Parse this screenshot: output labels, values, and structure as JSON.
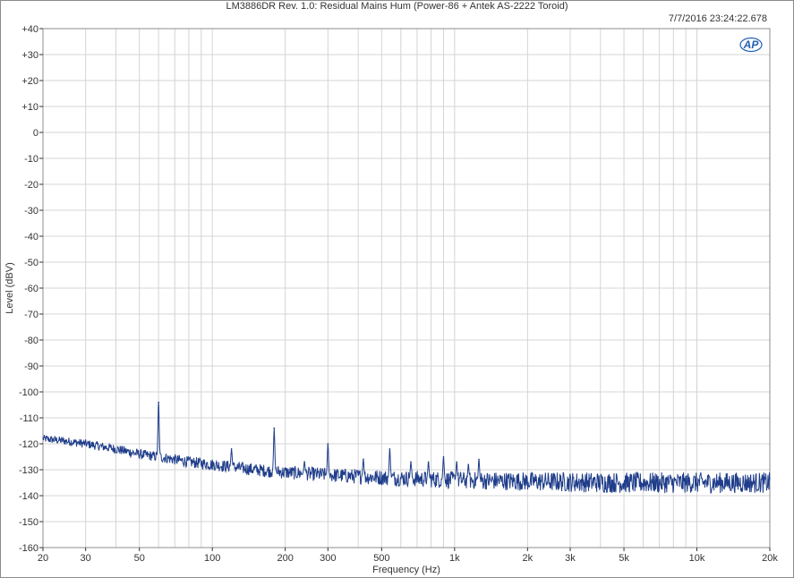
{
  "header": {
    "title": "LM3886DR Rev. 1.0: Residual Mains Hum (Power-86 + Antek AS-2222 Toroid)",
    "timestamp": "7/7/2016 23:24:22.678",
    "logo_text": "AP"
  },
  "colors": {
    "trace": "#1f3d8a",
    "grid": "#d4d4d4",
    "axis": "#333333",
    "logo": "#1e5fb4"
  },
  "chart_data": {
    "type": "line",
    "title": "LM3886DR Rev. 1.0: Residual Mains Hum (Power-86 + Antek AS-2222 Toroid)",
    "xlabel": "Frequency (Hz)",
    "ylabel": "Level (dBV)",
    "xscale": "log",
    "xlim": [
      20,
      20000
    ],
    "ylim": [
      -160,
      40
    ],
    "grid": true,
    "x_ticks": [
      {
        "value": 20,
        "label": "20"
      },
      {
        "value": 30,
        "label": "30"
      },
      {
        "value": 50,
        "label": "50"
      },
      {
        "value": 100,
        "label": "100"
      },
      {
        "value": 200,
        "label": "200"
      },
      {
        "value": 300,
        "label": "300"
      },
      {
        "value": 500,
        "label": "500"
      },
      {
        "value": 1000,
        "label": "1k"
      },
      {
        "value": 2000,
        "label": "2k"
      },
      {
        "value": 3000,
        "label": "3k"
      },
      {
        "value": 5000,
        "label": "5k"
      },
      {
        "value": 10000,
        "label": "10k"
      },
      {
        "value": 20000,
        "label": "20k"
      }
    ],
    "y_ticks": [
      {
        "value": 40,
        "label": "+40"
      },
      {
        "value": 30,
        "label": "+30"
      },
      {
        "value": 20,
        "label": "+20"
      },
      {
        "value": 10,
        "label": "+10"
      },
      {
        "value": 0,
        "label": "0"
      },
      {
        "value": -10,
        "label": "-10"
      },
      {
        "value": -20,
        "label": "-20"
      },
      {
        "value": -30,
        "label": "-30"
      },
      {
        "value": -40,
        "label": "-40"
      },
      {
        "value": -50,
        "label": "-50"
      },
      {
        "value": -60,
        "label": "-60"
      },
      {
        "value": -70,
        "label": "-70"
      },
      {
        "value": -80,
        "label": "-80"
      },
      {
        "value": -90,
        "label": "-90"
      },
      {
        "value": -100,
        "label": "-100"
      },
      {
        "value": -110,
        "label": "-110"
      },
      {
        "value": -120,
        "label": "-120"
      },
      {
        "value": -130,
        "label": "-130"
      },
      {
        "value": -140,
        "label": "-140"
      },
      {
        "value": -150,
        "label": "-150"
      },
      {
        "value": -160,
        "label": "-160"
      }
    ],
    "series": [
      {
        "noise_floor": {
          "x": [
            20,
            25,
            30,
            40,
            50,
            60,
            80,
            100,
            150,
            200,
            300,
            500,
            1000,
            2000,
            5000,
            10000,
            20000
          ],
          "y": [
            -118,
            -119,
            -120,
            -122,
            -124,
            -125,
            -127,
            -128,
            -130,
            -131,
            -132,
            -133,
            -134,
            -134.5,
            -135,
            -135,
            -135
          ]
        },
        "noise_ripple_db": [
          1.5,
          4
        ],
        "peaks": [
          {
            "x": 60,
            "y": -104
          },
          {
            "x": 120,
            "y": -122
          },
          {
            "x": 180,
            "y": -114
          },
          {
            "x": 240,
            "y": -127
          },
          {
            "x": 300,
            "y": -120
          },
          {
            "x": 420,
            "y": -126
          },
          {
            "x": 540,
            "y": -122
          },
          {
            "x": 660,
            "y": -127
          },
          {
            "x": 780,
            "y": -127
          },
          {
            "x": 900,
            "y": -125
          },
          {
            "x": 1020,
            "y": -127
          },
          {
            "x": 1140,
            "y": -128
          },
          {
            "x": 1260,
            "y": -126
          }
        ]
      }
    ]
  }
}
